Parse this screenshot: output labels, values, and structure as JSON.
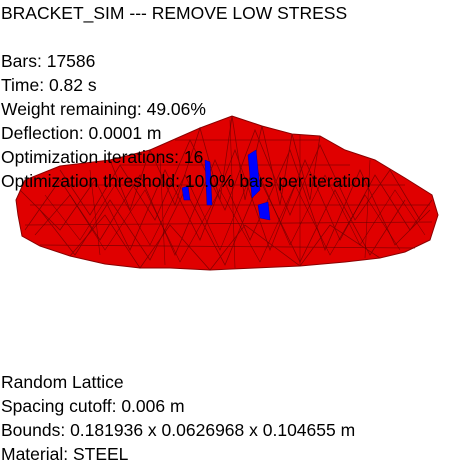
{
  "header": {
    "title": "BRACKET_SIM --- REMOVE LOW STRESS"
  },
  "stats": {
    "bars": "Bars: 17586",
    "time": "Time: 0.82 s",
    "weight": "Weight remaining: 49.06%",
    "deflection": "Deflection: 0.0001 m",
    "iterations": "Optimization iterations: 16",
    "threshold": "Optimization threshold: 10.0% bars per iteration"
  },
  "info": {
    "lattice": "Random Lattice",
    "spacing": "Spacing cutoff: 0.006 m",
    "bounds": "Bounds: 0.181936 x 0.0626968 x 0.104655 m",
    "material": "Material: STEEL"
  },
  "colors": {
    "low_stress": "#ff0000",
    "high_stress": "#0000ff",
    "background": "#ffffff"
  }
}
